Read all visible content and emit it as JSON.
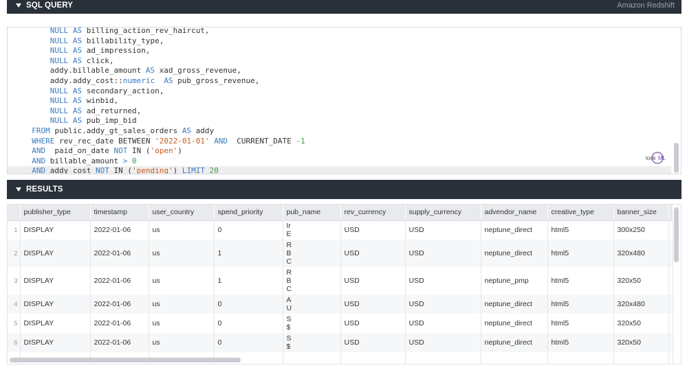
{
  "sql_panel": {
    "title": "SQL QUERY",
    "connection": "Amazon Redshift"
  },
  "results_panel": {
    "title": "RESULTS"
  },
  "editor": {
    "lines": [
      [
        {
          "t": "      "
        },
        {
          "t": "NULL",
          "c": "kw"
        },
        {
          "t": " "
        },
        {
          "t": "AS",
          "c": "kw"
        },
        {
          "t": " billing_action_rev_haircut,"
        }
      ],
      [
        {
          "t": "      "
        },
        {
          "t": "NULL",
          "c": "kw"
        },
        {
          "t": " "
        },
        {
          "t": "AS",
          "c": "kw"
        },
        {
          "t": " billability_type,"
        }
      ],
      [
        {
          "t": "      "
        },
        {
          "t": "NULL",
          "c": "kw"
        },
        {
          "t": " "
        },
        {
          "t": "AS",
          "c": "kw"
        },
        {
          "t": " ad_impression,"
        }
      ],
      [
        {
          "t": "      "
        },
        {
          "t": "NULL",
          "c": "kw"
        },
        {
          "t": " "
        },
        {
          "t": "AS",
          "c": "kw"
        },
        {
          "t": " click,"
        }
      ],
      [
        {
          "t": "      addy.billable_amount "
        },
        {
          "t": "AS",
          "c": "kw"
        },
        {
          "t": " xad_gross_revenue,"
        }
      ],
      [
        {
          "t": "      addy.addy_cost::"
        },
        {
          "t": "numeric",
          "c": "kw"
        },
        {
          "t": "  "
        },
        {
          "t": "AS",
          "c": "kw"
        },
        {
          "t": " pub_gross_revenue,"
        }
      ],
      [
        {
          "t": "      "
        },
        {
          "t": "NULL",
          "c": "kw"
        },
        {
          "t": " "
        },
        {
          "t": "AS",
          "c": "kw"
        },
        {
          "t": " secondary_action,"
        }
      ],
      [
        {
          "t": "      "
        },
        {
          "t": "NULL",
          "c": "kw"
        },
        {
          "t": " "
        },
        {
          "t": "AS",
          "c": "kw"
        },
        {
          "t": " winbid,"
        }
      ],
      [
        {
          "t": "      "
        },
        {
          "t": "NULL",
          "c": "kw"
        },
        {
          "t": " "
        },
        {
          "t": "AS",
          "c": "kw"
        },
        {
          "t": " ad_returned,"
        }
      ],
      [
        {
          "t": "      "
        },
        {
          "t": "NULL",
          "c": "kw"
        },
        {
          "t": " "
        },
        {
          "t": "AS",
          "c": "kw"
        },
        {
          "t": " pub_imp_bid"
        }
      ],
      [
        {
          "t": "  "
        },
        {
          "t": "FROM",
          "c": "kw"
        },
        {
          "t": " public.addy_gt_sales_orders "
        },
        {
          "t": "AS",
          "c": "kw"
        },
        {
          "t": " addy"
        }
      ],
      [
        {
          "t": "  "
        },
        {
          "t": "WHERE",
          "c": "kw"
        },
        {
          "t": " rev_rec_date BETWEEN "
        },
        {
          "t": "'2022-01-01'",
          "c": "str"
        },
        {
          "t": " "
        },
        {
          "t": "AND",
          "c": "kw"
        },
        {
          "t": "  CURRENT_DATE "
        },
        {
          "t": "-1",
          "c": "num"
        }
      ],
      [
        {
          "t": "  "
        },
        {
          "t": "AND",
          "c": "kw"
        },
        {
          "t": "  paid_on_date "
        },
        {
          "t": "NOT",
          "c": "kw"
        },
        {
          "t": " IN ("
        },
        {
          "t": "'open'",
          "c": "str"
        },
        {
          "t": ")"
        }
      ],
      [
        {
          "t": "  "
        },
        {
          "t": "AND",
          "c": "kw"
        },
        {
          "t": " billable_amount "
        },
        {
          "t": ">",
          "c": "kw"
        },
        {
          "t": " "
        },
        {
          "t": "0",
          "c": "num"
        }
      ],
      [
        {
          "t": "  "
        },
        {
          "t": "AND",
          "c": "kw"
        },
        {
          "t": " addy_cost "
        },
        {
          "t": "NOT",
          "c": "kw"
        },
        {
          "t": " IN ("
        },
        {
          "t": "'pending'",
          "c": "str"
        },
        {
          "t": ") "
        },
        {
          "t": "LIMIT",
          "c": "kw"
        },
        {
          "t": " "
        },
        {
          "t": "20",
          "c": "num"
        }
      ]
    ],
    "active_line": 14,
    "lookml_logo": "lookml-logo"
  },
  "table": {
    "columns": [
      "publisher_type",
      "timestamp",
      "user_country",
      "spend_priority",
      "pub_name",
      "rev_currency",
      "supply_currency",
      "advendor_name",
      "creative_type",
      "banner_size"
    ],
    "rows": [
      {
        "n": "1",
        "publisher_type": "DISPLAY",
        "timestamp": "2022-01-06",
        "user_country": "us",
        "spend_priority": "0",
        "pub_name": [
          "Ir",
          "E"
        ],
        "rev_currency": "USD",
        "supply_currency": "USD",
        "advendor_name": "neptune_direct",
        "creative_type": "html5",
        "banner_size": "300x250"
      },
      {
        "n": "2",
        "publisher_type": "DISPLAY",
        "timestamp": "2022-01-06",
        "user_country": "us",
        "spend_priority": "1",
        "pub_name": [
          "R",
          "B",
          "C"
        ],
        "rev_currency": "USD",
        "supply_currency": "USD",
        "advendor_name": "neptune_direct",
        "creative_type": "html5",
        "banner_size": "320x480"
      },
      {
        "n": "3",
        "publisher_type": "DISPLAY",
        "timestamp": "2022-01-06",
        "user_country": "us",
        "spend_priority": "1",
        "pub_name": [
          "R",
          "B",
          "C"
        ],
        "rev_currency": "USD",
        "supply_currency": "USD",
        "advendor_name": "neptune_pmp",
        "creative_type": "html5",
        "banner_size": "320x50"
      },
      {
        "n": "4",
        "publisher_type": "DISPLAY",
        "timestamp": "2022-01-06",
        "user_country": "us",
        "spend_priority": "0",
        "pub_name": [
          "A",
          "U"
        ],
        "rev_currency": "USD",
        "supply_currency": "USD",
        "advendor_name": "neptune_direct",
        "creative_type": "html5",
        "banner_size": "320x480"
      },
      {
        "n": "5",
        "publisher_type": "DISPLAY",
        "timestamp": "2022-01-06",
        "user_country": "us",
        "spend_priority": "0",
        "pub_name": [
          "S",
          "$"
        ],
        "rev_currency": "USD",
        "supply_currency": "USD",
        "advendor_name": "neptune_direct",
        "creative_type": "html5",
        "banner_size": "320x50"
      },
      {
        "n": "6",
        "publisher_type": "DISPLAY",
        "timestamp": "2022-01-06",
        "user_country": "us",
        "spend_priority": "0",
        "pub_name": [
          "S",
          "$"
        ],
        "rev_currency": "USD",
        "supply_currency": "USD",
        "advendor_name": "neptune_direct",
        "creative_type": "html5",
        "banner_size": "320x50"
      }
    ]
  }
}
